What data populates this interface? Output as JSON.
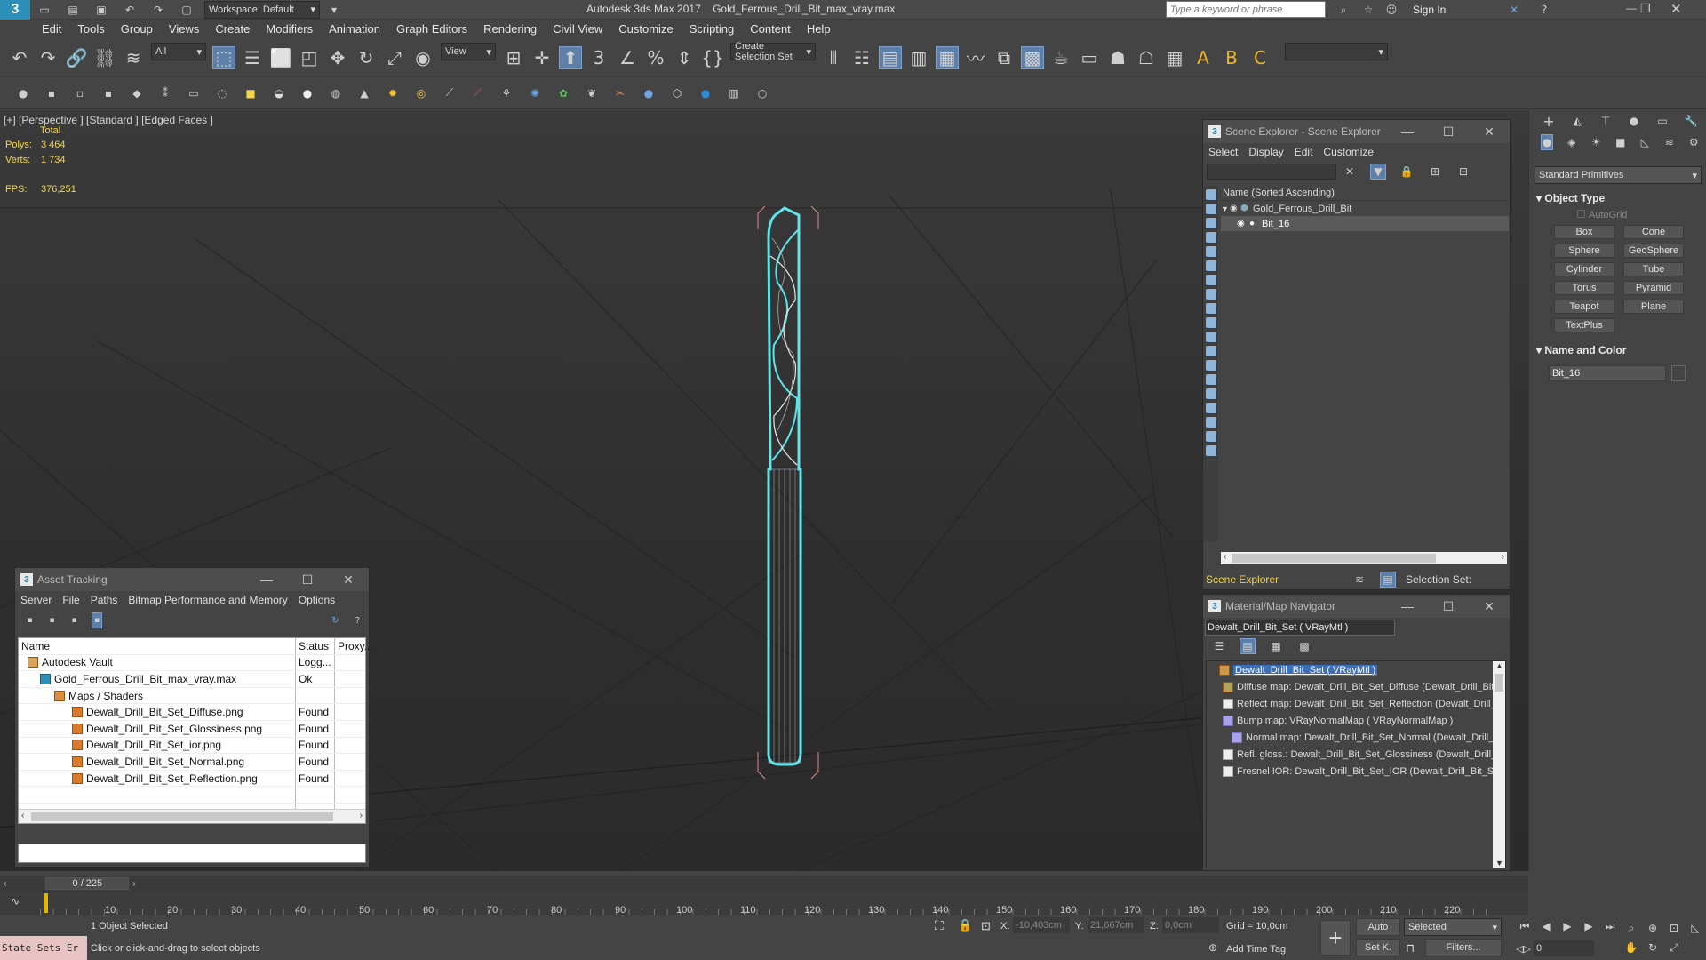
{
  "app": {
    "title": "Autodesk 3ds Max 2017",
    "file": "Gold_Ferrous_Drill_Bit_max_vray.max",
    "workspace": "Workspace: Default",
    "search_placeholder": "Type a keyword or phrase",
    "sign_in": "Sign In"
  },
  "menu": [
    "Edit",
    "Tools",
    "Group",
    "Views",
    "Create",
    "Modifiers",
    "Animation",
    "Graph Editors",
    "Rendering",
    "Civil View",
    "Customize",
    "Scripting",
    "Content",
    "Help"
  ],
  "toolbar": {
    "filter": "All",
    "ref_coord": "View",
    "selection_set": "Create Selection Set"
  },
  "viewport": {
    "label": "[+] [Perspective ] [Standard ] [Edged Faces ]",
    "total_label": "Total",
    "polys_label": "Polys:",
    "polys_value": "3 464",
    "verts_label": "Verts:",
    "verts_value": "1 734",
    "fps_label": "FPS:",
    "fps_value": "376,251"
  },
  "asset_tracking": {
    "title": "Asset Tracking",
    "menu": [
      "Server",
      "File",
      "Paths",
      "Bitmap Performance and Memory",
      "Options"
    ],
    "columns": {
      "name": "Name",
      "status": "Status",
      "proxy": "Proxy..."
    },
    "rows": [
      {
        "name": "Autodesk Vault",
        "status": "Logg...",
        "indent": 0,
        "icon": "vault-icon"
      },
      {
        "name": "Gold_Ferrous_Drill_Bit_max_vray.max",
        "status": "Ok",
        "indent": 1,
        "icon": "max-file-icon"
      },
      {
        "name": "Maps / Shaders",
        "status": "",
        "indent": 2,
        "icon": "folder-icon"
      },
      {
        "name": "Dewalt_Drill_Bit_Set_Diffuse.png",
        "status": "Found",
        "indent": 3,
        "icon": "image-file-icon"
      },
      {
        "name": "Dewalt_Drill_Bit_Set_Glossiness.png",
        "status": "Found",
        "indent": 3,
        "icon": "image-file-icon"
      },
      {
        "name": "Dewalt_Drill_Bit_Set_ior.png",
        "status": "Found",
        "indent": 3,
        "icon": "image-file-icon"
      },
      {
        "name": "Dewalt_Drill_Bit_Set_Normal.png",
        "status": "Found",
        "indent": 3,
        "icon": "image-file-icon"
      },
      {
        "name": "Dewalt_Drill_Bit_Set_Reflection.png",
        "status": "Found",
        "indent": 3,
        "icon": "image-file-icon"
      }
    ]
  },
  "scene_explorer": {
    "title": "Scene Explorer - Scene Explorer",
    "menu": [
      "Select",
      "Display",
      "Edit",
      "Customize"
    ],
    "column": "Name (Sorted Ascending)",
    "items": [
      "Gold_Ferrous_Drill_Bit",
      "Bit_16"
    ],
    "footer_label": "Scene Explorer",
    "selection_set_label": "Selection Set:"
  },
  "material_navigator": {
    "title": "Material/Map Navigator",
    "material_field": "Dewalt_Drill_Bit_Set  ( VRayMtl )",
    "items": [
      "Dewalt_Drill_Bit_Set  ( VRayMtl )",
      "Diffuse map: Dewalt_Drill_Bit_Set_Diffuse (Dewalt_Drill_Bit_S",
      "Reflect map: Dewalt_Drill_Bit_Set_Reflection (Dewalt_Drill_Bi",
      "Bump map: VRayNormalMap  ( VRayNormalMap )",
      "Normal map: Dewalt_Drill_Bit_Set_Normal (Dewalt_Drill_Bit",
      "Refl. gloss.: Dewalt_Drill_Bit_Set_Glossiness (Dewalt_Drill_Bit",
      "Fresnel IOR: Dewalt_Drill_Bit_Set_IOR (Dewalt_Drill_Bit_Set_"
    ]
  },
  "command_panel": {
    "category": "Standard Primitives",
    "object_type": "Object Type",
    "autogrid": "AutoGrid",
    "buttons": [
      "Box",
      "Cone",
      "Sphere",
      "GeoSphere",
      "Cylinder",
      "Tube",
      "Torus",
      "Pyramid",
      "Teapot",
      "Plane",
      "TextPlus"
    ],
    "name_and_color": "Name and Color",
    "object_name": "Bit_16"
  },
  "timeline": {
    "frame": "0 / 225",
    "ticks": [
      "10",
      "20",
      "30",
      "40",
      "50",
      "60",
      "70",
      "80",
      "90",
      "100",
      "110",
      "120",
      "130",
      "140",
      "150",
      "160",
      "170",
      "180",
      "190",
      "200",
      "210",
      "220"
    ]
  },
  "status": {
    "maxscript": "State Sets Er",
    "selected": "1 Object Selected",
    "prompt": "Click or click-and-drag to select objects",
    "x_label": "X:",
    "x_value": "-10,403cm",
    "y_label": "Y:",
    "y_value": "21,667cm",
    "z_label": "Z:",
    "z_value": "0,0cm",
    "grid": "Grid = 10,0cm",
    "add_time_tag": "Add Time Tag",
    "auto": "Auto",
    "set_k": "Set K.",
    "selected_dropdown": "Selected",
    "filters": "Filters...",
    "frame_value": "0"
  },
  "colors": {
    "wire_highlight": "#5fe4ea",
    "stats": "#f2d54a",
    "selection_blue": "#5e7fa8"
  }
}
